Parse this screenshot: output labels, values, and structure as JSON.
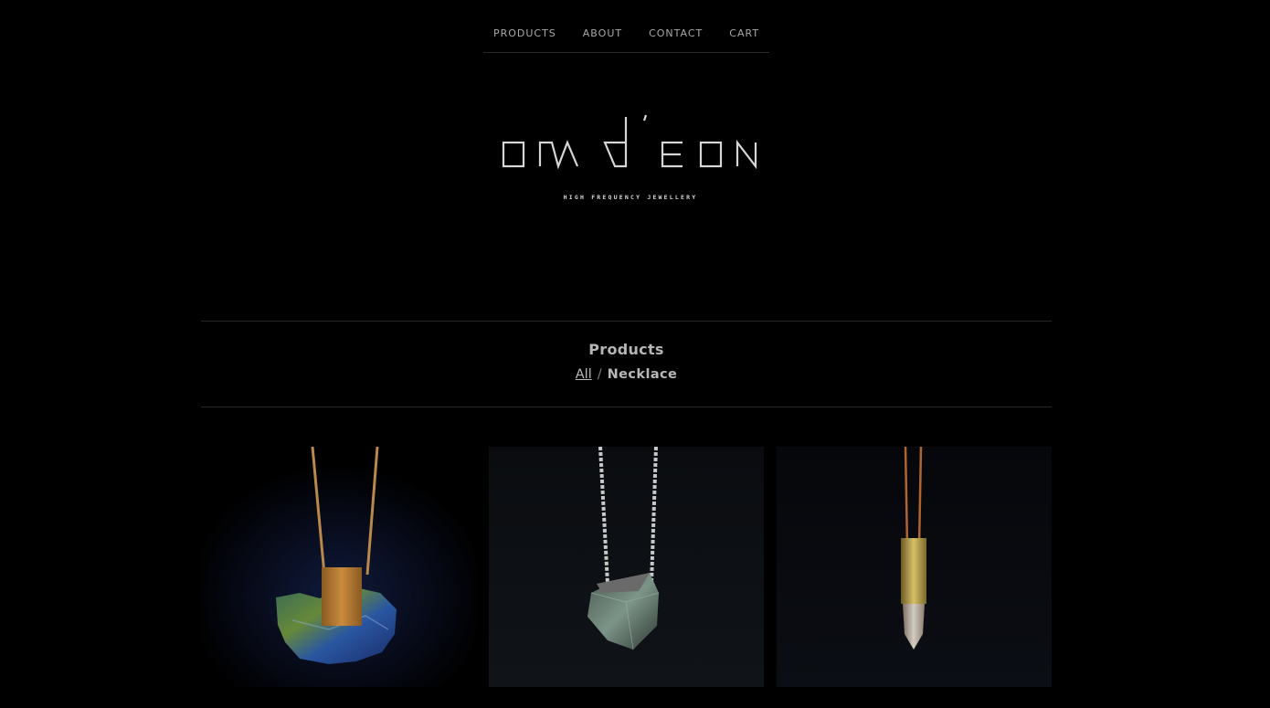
{
  "nav": {
    "items": [
      {
        "label": "PRODUCTS"
      },
      {
        "label": "ABOUT"
      },
      {
        "label": "CONTACT"
      },
      {
        "label": "CART"
      }
    ]
  },
  "brand": {
    "logo_text": "om d'eon",
    "tagline": "HIGH FREQUENCY JEWELLERY"
  },
  "section": {
    "title": "Products",
    "breadcrumb": {
      "all_label": "All",
      "separator": "/",
      "current": "Necklace"
    }
  },
  "products": [
    {
      "image": "labradorite-pendant-gold-chain"
    },
    {
      "image": "fluorite-octahedron-pendant-silver-chain"
    },
    {
      "image": "quartz-point-pendant-brass-cap"
    }
  ],
  "colors": {
    "background": "#000000",
    "text": "#b5b5b5",
    "divider": "#262626"
  }
}
